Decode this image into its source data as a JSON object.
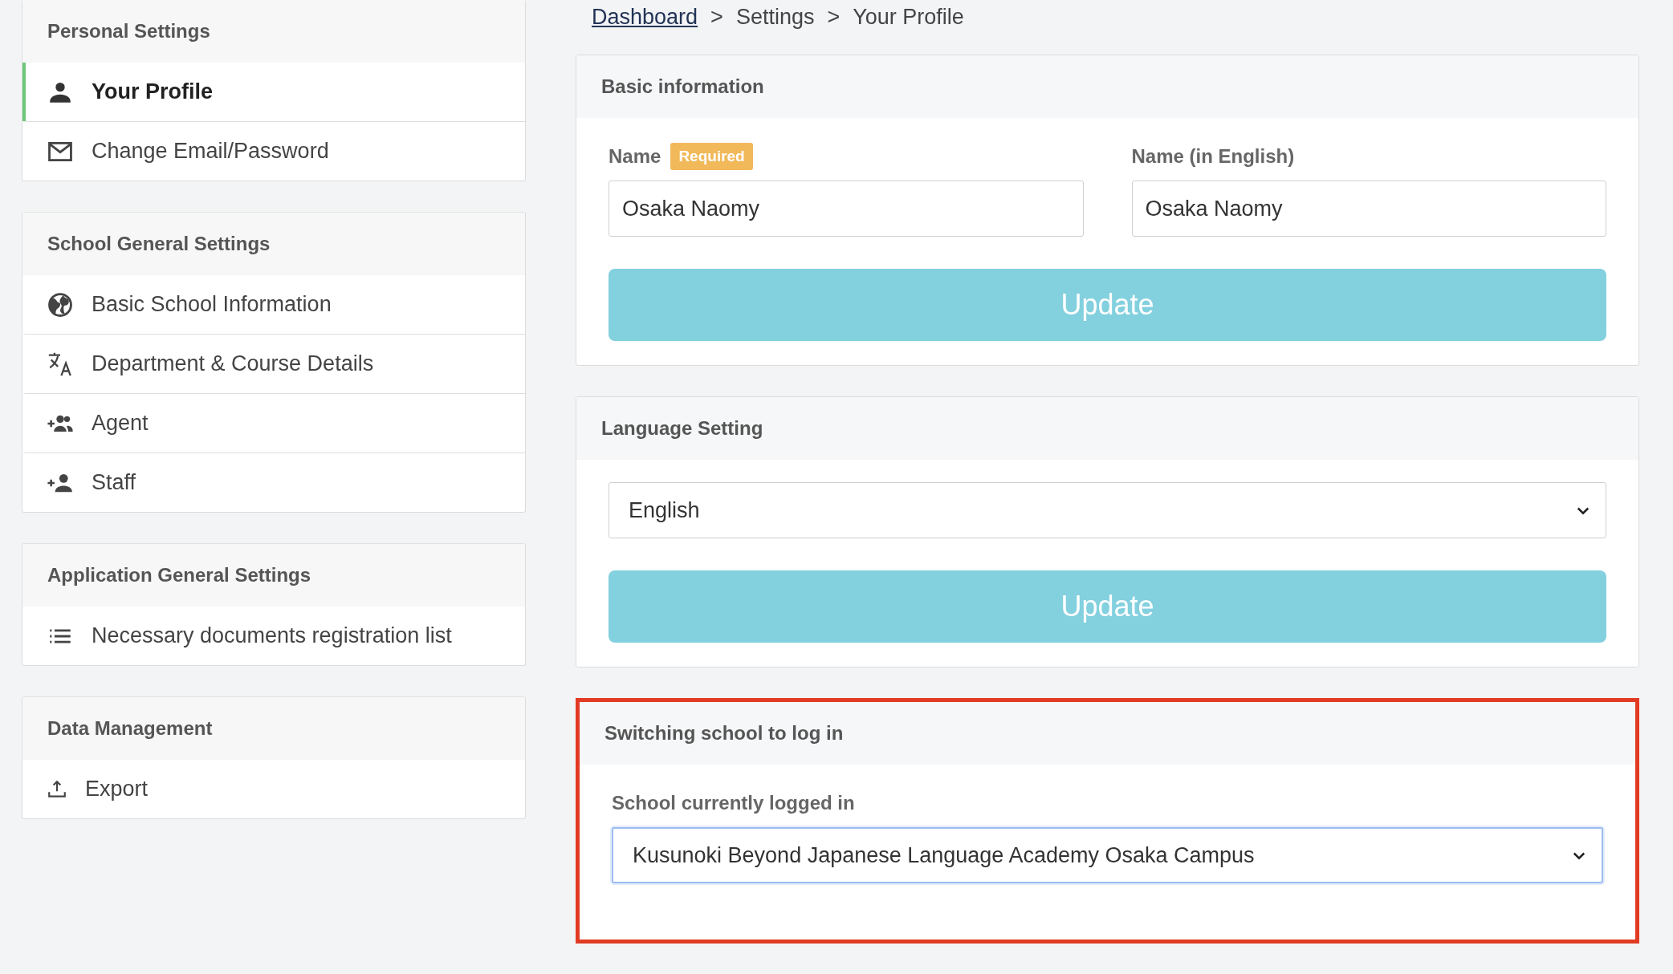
{
  "sidebar": {
    "sections": [
      {
        "title": "Personal Settings",
        "items": [
          {
            "label": "Your Profile",
            "selected": true
          },
          {
            "label": "Change Email/Password",
            "selected": false
          }
        ]
      },
      {
        "title": "School General Settings",
        "items": [
          {
            "label": "Basic School Information",
            "selected": false
          },
          {
            "label": "Department & Course Details",
            "selected": false
          },
          {
            "label": "Agent",
            "selected": false
          },
          {
            "label": "Staff",
            "selected": false
          }
        ]
      },
      {
        "title": "Application General Settings",
        "items": [
          {
            "label": "Necessary documents registration list",
            "selected": false
          }
        ]
      },
      {
        "title": "Data Management",
        "items": [
          {
            "label": "Export",
            "selected": false
          }
        ]
      }
    ]
  },
  "breadcrumb": [
    {
      "kind": "link",
      "label": "Dashboard"
    },
    {
      "kind": "separator",
      "label": ">"
    },
    {
      "kind": "text",
      "label": "Settings"
    },
    {
      "kind": "separator",
      "label": ">"
    },
    {
      "kind": "text",
      "label": "Your Profile"
    }
  ],
  "basic_information": {
    "title": "Basic information",
    "fields": [
      {
        "label": "Name",
        "badge": "Required",
        "value": "Osaka Naomy"
      },
      {
        "label": "Name (in English)",
        "value": "Osaka Naomy"
      }
    ],
    "button": "Update"
  },
  "language_setting": {
    "title": "Language Setting",
    "select": {
      "value": "English"
    },
    "button": "Update"
  },
  "school_switch": {
    "title": "Switching school to log in",
    "highlighted": true,
    "field": {
      "label": "School currently logged in",
      "value": "Kusunoki Beyond Japanese Language Academy Osaka Campus",
      "focused": true
    }
  }
}
